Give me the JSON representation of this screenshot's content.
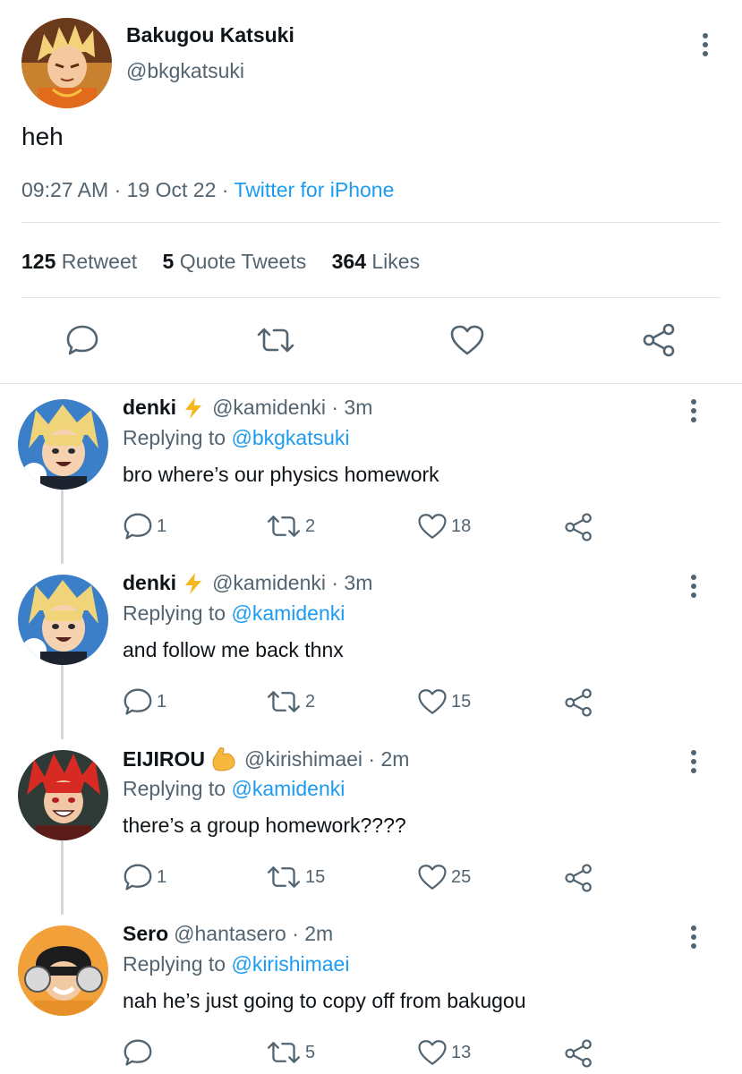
{
  "main_tweet": {
    "author_name": "Bakugou Katsuki",
    "author_handle": "@bkgkatsuki",
    "text": "heh",
    "time": "09:27 AM",
    "separator": "·",
    "date": "19 Oct 22",
    "source": "Twitter for iPhone",
    "stats": {
      "retweets_count": "125",
      "retweets_label": "Retweet",
      "quotes_count": "5",
      "quotes_label": "Quote Tweets",
      "likes_count": "364",
      "likes_label": "Likes"
    }
  },
  "replies": [
    {
      "name": "denki",
      "emoji": "lightning-emoji",
      "handle": "@kamidenki",
      "time": "· 3m",
      "replying_prefix": "Replying to",
      "replying_to": "@bkgkatsuki",
      "text": "bro where’s our physics homework",
      "replies": "1",
      "retweets": "2",
      "likes": "18"
    },
    {
      "name": "denki",
      "emoji": "lightning-emoji",
      "handle": "@kamidenki",
      "time": "· 3m",
      "replying_prefix": "Replying to",
      "replying_to": "@kamidenki",
      "text": "and follow me back thnx",
      "replies": "1",
      "retweets": "2",
      "likes": "15"
    },
    {
      "name": "EIJIROU",
      "emoji": "flexed-biceps-emoji",
      "handle": "@kirishimaei",
      "time": "· 2m",
      "replying_prefix": "Replying to",
      "replying_to": "@kamidenki",
      "text": "there’s a group homework????",
      "replies": "1",
      "retweets": "15",
      "likes": "25"
    },
    {
      "name": "Sero",
      "emoji": "",
      "handle": "@hantasero",
      "time": "· 2m",
      "replying_prefix": "Replying to",
      "replying_to": "@kirishimaei",
      "text": "nah he’s just going to copy off from bakugou",
      "replies": "",
      "retweets": "5",
      "likes": "13"
    }
  ],
  "colors": {
    "text_primary": "#0f1419",
    "text_secondary": "#536471",
    "link": "#1d9bf0",
    "divider": "#dfe4e8"
  }
}
